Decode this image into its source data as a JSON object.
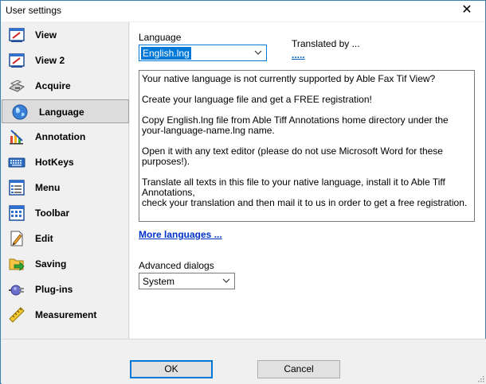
{
  "window": {
    "title": "User settings",
    "close_glyph": "✕"
  },
  "sidebar": {
    "items": [
      {
        "label": "View",
        "icon": "view-icon"
      },
      {
        "label": "View 2",
        "icon": "view2-icon"
      },
      {
        "label": "Acquire",
        "icon": "scanner-icon"
      },
      {
        "label": "Language",
        "icon": "globe-icon",
        "active": true
      },
      {
        "label": "Annotation",
        "icon": "annotation-icon"
      },
      {
        "label": "HotKeys",
        "icon": "keyboard-icon"
      },
      {
        "label": "Menu",
        "icon": "menu-icon"
      },
      {
        "label": "Toolbar",
        "icon": "toolbar-icon"
      },
      {
        "label": "Edit",
        "icon": "edit-icon"
      },
      {
        "label": "Saving",
        "icon": "save-icon"
      },
      {
        "label": "Plug-ins",
        "icon": "plugin-icon"
      },
      {
        "label": "Measurement",
        "icon": "ruler-icon"
      }
    ]
  },
  "language": {
    "label": "Language",
    "selected": "English.lng",
    "translated_by_label": "Translated by ...",
    "translator_link": ".....",
    "info_paragraphs": [
      "Your native language is not currently supported by Able Fax Tif View?",
      "Create your language file and get a FREE registration!",
      "Copy English.lng file from Able Tiff Annotations home directory under the\nyour-language-name.lng name.",
      "Open it with any text editor (please do not use Microsoft Word for these purposes!).",
      "Translate all texts in this file to your native language, install it to Able Tiff Annotations,\ncheck your translation and then mail it to us  in order to get a free registration."
    ],
    "more_languages": "More languages ..."
  },
  "advanced": {
    "label": "Advanced dialogs",
    "selected": "System"
  },
  "footer": {
    "ok_label": "OK",
    "cancel_label": "Cancel"
  },
  "colors": {
    "accent": "#0078d7",
    "link": "#0033cc",
    "window_border": "#3c7fb1"
  }
}
